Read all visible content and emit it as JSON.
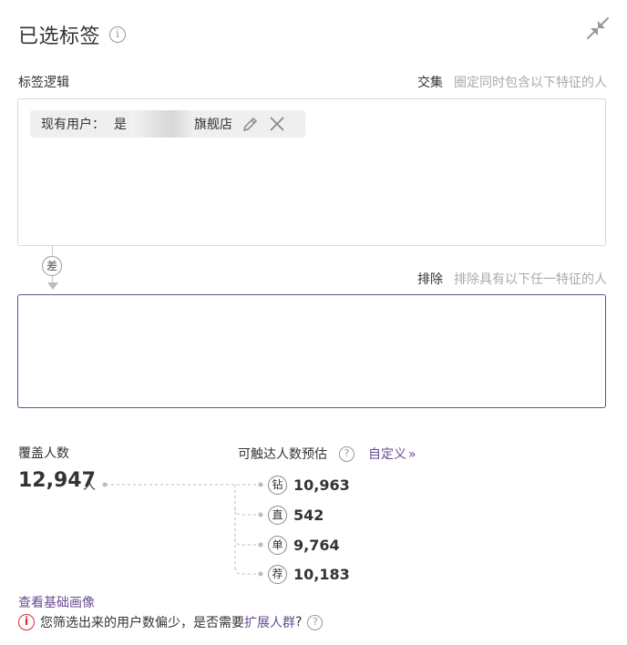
{
  "header": {
    "title": "已选标签",
    "info_icon": "info-icon",
    "collapse_icon": "collapse-arrows-icon"
  },
  "include_section": {
    "label": "标签逻辑",
    "mode": "交集",
    "mode_desc": "圈定同时包含以下特征的人",
    "tags": [
      {
        "prefix": "现有用户：",
        "value_prefix": "是",
        "value_suffix": "旗舰店"
      }
    ]
  },
  "connector": {
    "badge": "差"
  },
  "exclude_section": {
    "mode": "排除",
    "mode_desc": "排除具有以下任一特征的人"
  },
  "coverage": {
    "label": "覆盖人数",
    "value": "12,947",
    "unit": "人"
  },
  "reach": {
    "label": "可触达人数预估",
    "help_icon": "question-icon",
    "custom_link": "自定义",
    "channels": [
      {
        "badge": "钻",
        "value": "10,963"
      },
      {
        "badge": "直",
        "value": "542"
      },
      {
        "badge": "单",
        "value": "9,764"
      },
      {
        "badge": "荐",
        "value": "10,183"
      }
    ]
  },
  "footer": {
    "view_link": "查看基础画像",
    "warning_text": "您筛选出来的用户数偏少，是否需要",
    "warning_link": "扩展人群",
    "warning_qmark": "?",
    "warning_icon": "alert-circle-icon"
  },
  "colors": {
    "accent": "#6a4c93",
    "warning": "#e0282e",
    "muted": "#aaaaaa"
  }
}
